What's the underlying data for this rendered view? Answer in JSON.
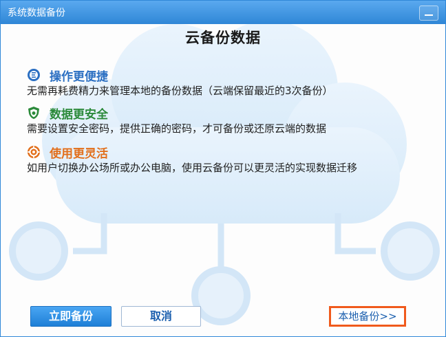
{
  "window": {
    "title": "系统数据备份"
  },
  "heading": "云备份数据",
  "features": [
    {
      "title": "操作更便捷",
      "desc": "无需再耗费精力来管理本地的备份数据（云端保留最近的3次备份）",
      "icon": "e-circle-icon"
    },
    {
      "title": "数据更安全",
      "desc": "需要设置安全密码，提供正确的密码，才可备份或还原云端的数据",
      "icon": "shield-icon"
    },
    {
      "title": "使用更灵活",
      "desc": "如用户切换办公场所或办公电脑，使用云备份可以更灵活的实现数据迁移",
      "icon": "flexible-icon"
    }
  ],
  "buttons": {
    "backup_now": "立即备份",
    "cancel": "取消",
    "local_backup": "本地备份>>"
  },
  "colors": {
    "titlebar": "#2f86d6",
    "feature1": "#2b6fc2",
    "feature2": "#2b8a3a",
    "feature3": "#e26f1b",
    "highlight": "#f05a1c"
  }
}
